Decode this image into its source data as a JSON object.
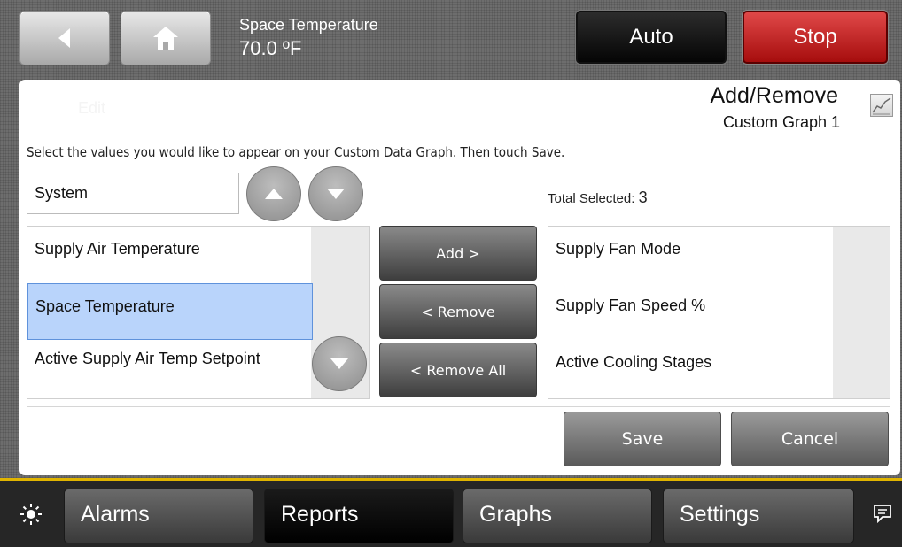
{
  "header": {
    "title": "Space Temperature",
    "value": "70.0 ºF",
    "back_icon": "back-arrow-icon",
    "home_icon": "home-icon",
    "auto_label": "Auto",
    "stop_label": "Stop"
  },
  "panel": {
    "edit_label": "Edit",
    "title": "Add/Remove",
    "subtitle": "Custom Graph 1",
    "graph_icon": "line-graph-icon",
    "instruction": "Select the values you would like to appear on your Custom Data Graph. Then touch Save.",
    "category_select": "System",
    "total_label": "Total Selected:",
    "total_value": "3"
  },
  "available_list": [
    {
      "label": "Supply Air Temperature",
      "selected": false
    },
    {
      "label": "Space Temperature",
      "selected": true
    },
    {
      "label": "Active Supply Air Temp Setpoint",
      "selected": false
    }
  ],
  "selected_list": [
    {
      "label": "Supply Fan Mode"
    },
    {
      "label": "Supply Fan Speed %"
    },
    {
      "label": "Active Cooling Stages"
    }
  ],
  "actions": {
    "add": "Add >",
    "remove": "< Remove",
    "remove_all": "< Remove All",
    "save": "Save",
    "cancel": "Cancel"
  },
  "nav": {
    "brightness_icon": "sun-icon",
    "items": [
      {
        "label": "Alarms",
        "active": false
      },
      {
        "label": "Reports",
        "active": true
      },
      {
        "label": "Graphs",
        "active": false
      },
      {
        "label": "Settings",
        "active": false
      }
    ],
    "message_icon": "message-icon"
  },
  "colors": {
    "stop_red": "#c41e1e",
    "nav_accent": "#e0b400",
    "selection_blue": "#b9d4fb"
  }
}
